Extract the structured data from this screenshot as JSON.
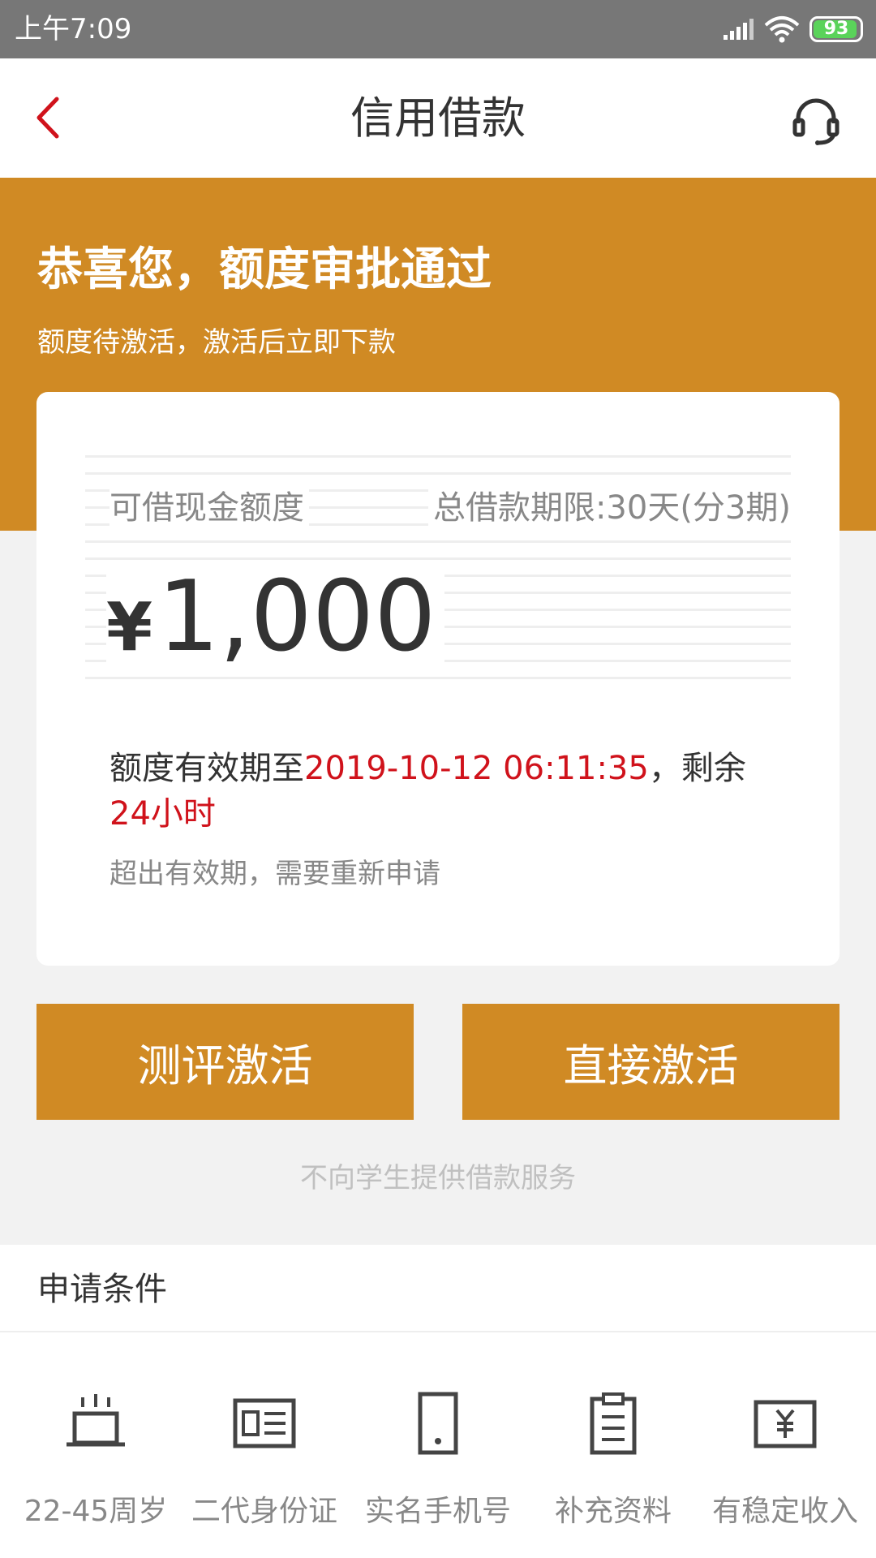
{
  "status_bar": {
    "time": "上午7:09",
    "battery": "93",
    "icons": [
      "signal-icon",
      "wifi-icon",
      "battery-icon"
    ]
  },
  "nav": {
    "title": "信用借款",
    "back_icon": "chevron-left-icon",
    "service_icon": "headset-icon"
  },
  "header": {
    "title": "恭喜您，额度审批通过",
    "subtitle": "额度待激活，激活后立即下款"
  },
  "card": {
    "quota_label": "可借现金额度",
    "term_label": "总借款期限:30天(分3期)",
    "currency": "¥",
    "amount": "1,000",
    "validity_prefix": "额度有效期至",
    "validity_date": "2019-10-12 06:11:35",
    "validity_mid": "，剩余",
    "validity_remaining": "24小时",
    "expire_note": "超出有效期，需要重新申请"
  },
  "buttons": {
    "evaluate": "测评激活",
    "direct": "直接激活"
  },
  "notice": "不向学生提供借款服务",
  "conditions": {
    "title": "申请条件",
    "items": [
      {
        "label": "22-45周岁",
        "icon": "cake-icon"
      },
      {
        "label": "二代身份证",
        "icon": "id-card-icon"
      },
      {
        "label": "实名手机号",
        "icon": "phone-icon"
      },
      {
        "label": "补充资料",
        "icon": "clipboard-icon"
      },
      {
        "label": "有稳定收入",
        "icon": "income-icon"
      }
    ]
  },
  "colors": {
    "accent": "#d08a24",
    "highlight": "#d0121b",
    "status_bar": "#777777",
    "battery": "#5ad35a"
  }
}
